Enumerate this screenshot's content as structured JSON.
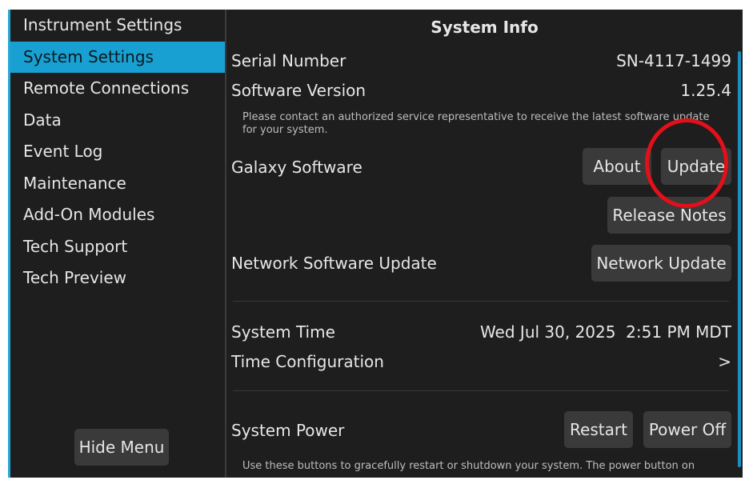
{
  "sidebar": {
    "items": [
      {
        "label": "Instrument Settings",
        "active": false
      },
      {
        "label": "System Settings",
        "active": true
      },
      {
        "label": "Remote Connections",
        "active": false
      },
      {
        "label": "Data",
        "active": false
      },
      {
        "label": "Event Log",
        "active": false
      },
      {
        "label": "Maintenance",
        "active": false
      },
      {
        "label": "Add-On Modules",
        "active": false
      },
      {
        "label": "Tech Support",
        "active": false
      },
      {
        "label": "Tech Preview",
        "active": false
      }
    ],
    "hide_menu_label": "Hide Menu"
  },
  "main": {
    "title": "System Info",
    "serial_number": {
      "label": "Serial Number",
      "value": "SN-4117-1499"
    },
    "software_version": {
      "label": "Software Version",
      "value": "1.25.4"
    },
    "update_note": "Please contact an authorized service representative to receive the latest software update for your system.",
    "galaxy_software": {
      "label": "Galaxy Software",
      "about_label": "About",
      "update_label": "Update",
      "release_notes_label": "Release Notes"
    },
    "network_software_update": {
      "label": "Network Software Update",
      "button_label": "Network Update"
    },
    "system_time": {
      "label": "System Time",
      "value": "Wed Jul 30, 2025  2:51 PM MDT"
    },
    "time_configuration": {
      "label": "Time Configuration",
      "chevron": ">"
    },
    "system_power": {
      "label": "System Power",
      "restart_label": "Restart",
      "power_off_label": "Power Off"
    },
    "power_note": "Use these buttons to gracefully restart or shutdown your system.  The power button on"
  },
  "colors": {
    "accent": "#19a0d2",
    "background": "#1e1e1e",
    "button": "#3a3a3a",
    "highlight": "#e3101a"
  }
}
